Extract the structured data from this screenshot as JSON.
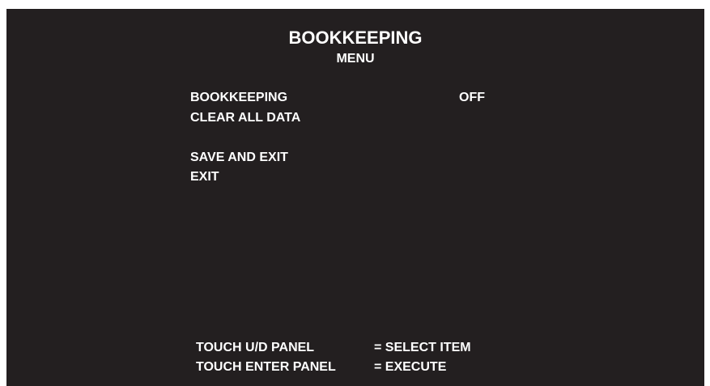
{
  "header": {
    "title": "BOOKKEEPING",
    "subtitle": "MENU"
  },
  "menu": {
    "items": [
      {
        "label": "BOOKKEEPING",
        "value": "OFF"
      },
      {
        "label": "CLEAR ALL DATA"
      },
      {
        "label": "SAVE AND EXIT"
      },
      {
        "label": "EXIT"
      }
    ]
  },
  "footer": {
    "lines": [
      {
        "key": "TOUCH U/D PANEL",
        "action": "= SELECT ITEM"
      },
      {
        "key": "TOUCH ENTER PANEL",
        "action": "= EXECUTE"
      }
    ]
  },
  "colors": {
    "background": "#231f20",
    "text": "#ffffff"
  }
}
